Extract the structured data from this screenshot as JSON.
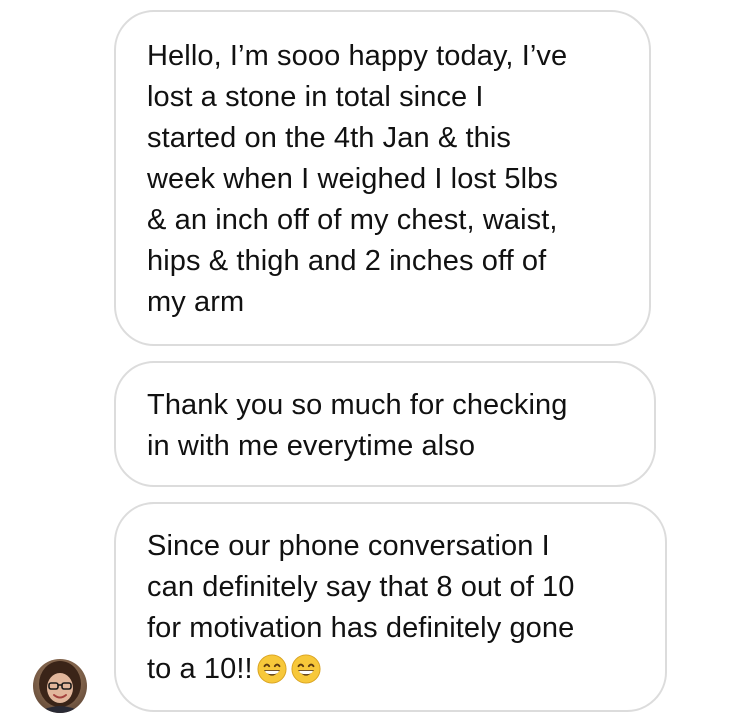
{
  "messages": [
    {
      "text": "Hello, I’m sooo happy today, I’ve\nlost a stone in total since I\nstarted on the 4th Jan & this\nweek when I weighed I lost 5lbs\n& an inch off of my chest, waist,\nhips & thigh and 2 inches off of\nmy arm"
    },
    {
      "text": "Thank you so much for checking\nin with me everytime also"
    },
    {
      "text": "Since our phone conversation I\ncan definitely say that 8 out of 10\nfor motivation has definitely gone\nto a 10!!",
      "emojis": [
        "grinning-face-with-smiling-eyes-icon",
        "grinning-face-with-smiling-eyes-icon"
      ]
    }
  ],
  "sender": {
    "avatar_icon": "user-avatar-photo"
  },
  "colors": {
    "bubble_border": "#dcdcdc",
    "text": "#111111",
    "emoji_yellow": "#f7c83a"
  }
}
